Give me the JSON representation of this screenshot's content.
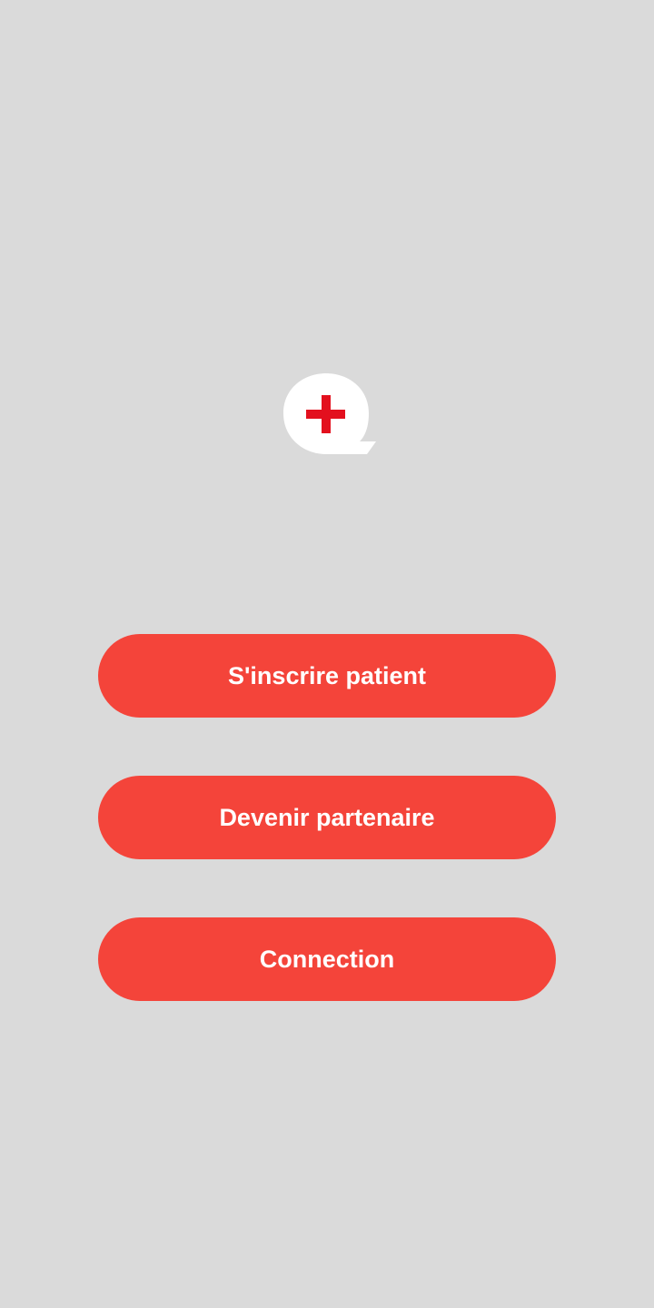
{
  "colors": {
    "background": "#dadada",
    "button": "#f4443a",
    "button_text": "#ffffff",
    "logo_cross": "#e3101e",
    "logo_bubble": "#ffffff"
  },
  "logo": {
    "icon": "medical-cross-speech-bubble-icon"
  },
  "buttons": {
    "register_patient": "S'inscrire patient",
    "become_partner": "Devenir partenaire",
    "login": "Connection"
  }
}
